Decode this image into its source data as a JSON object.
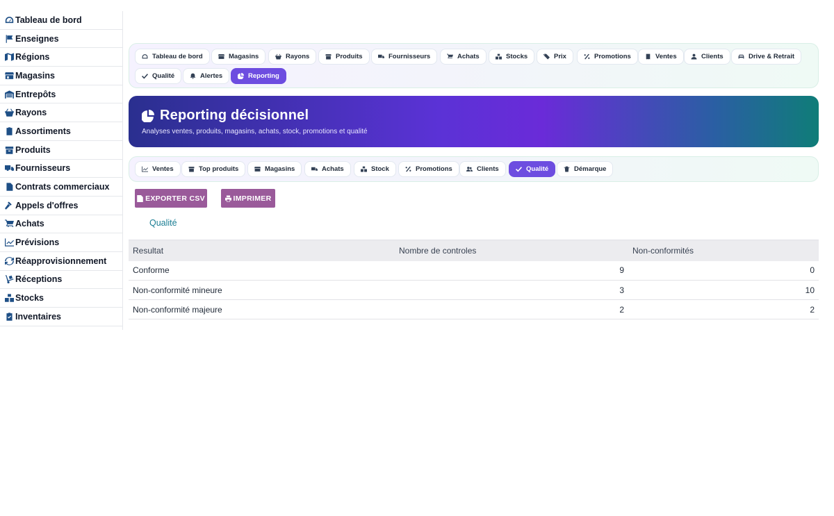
{
  "sidebar": {
    "items": [
      {
        "label": "Tableau de bord",
        "icon": "dashboard-icon"
      },
      {
        "label": "Enseignes",
        "icon": "flag-icon"
      },
      {
        "label": "Régions",
        "icon": "map-icon"
      },
      {
        "label": "Magasins",
        "icon": "store-icon"
      },
      {
        "label": "Entrepôts",
        "icon": "warehouse-icon"
      },
      {
        "label": "Rayons",
        "icon": "basket-icon"
      },
      {
        "label": "Assortiments",
        "icon": "clipboard-icon"
      },
      {
        "label": "Produits",
        "icon": "box-icon"
      },
      {
        "label": "Fournisseurs",
        "icon": "truck-icon"
      },
      {
        "label": "Contrats commerciaux",
        "icon": "contract-icon"
      },
      {
        "label": "Appels d'offres",
        "icon": "gavel-icon"
      },
      {
        "label": "Achats",
        "icon": "cart-icon"
      },
      {
        "label": "Prévisions",
        "icon": "chart-line-icon"
      },
      {
        "label": "Réapprovisionnement",
        "icon": "refresh-icon"
      },
      {
        "label": "Réceptions",
        "icon": "dolly-icon"
      },
      {
        "label": "Stocks",
        "icon": "cubes-icon"
      },
      {
        "label": "Inventaires",
        "icon": "clipboard-check-icon"
      }
    ]
  },
  "topnav": {
    "items": [
      {
        "label": "Tableau de bord"
      },
      {
        "label": "Magasins"
      },
      {
        "label": "Rayons"
      },
      {
        "label": "Produits"
      },
      {
        "label": "Fournisseurs"
      },
      {
        "label": "Achats"
      },
      {
        "label": "Stocks"
      },
      {
        "label": "Prix"
      },
      {
        "label": "Promotions"
      },
      {
        "label": "Ventes"
      },
      {
        "label": "Clients"
      },
      {
        "label": "Drive & Retrait"
      },
      {
        "label": "Qualité"
      },
      {
        "label": "Alertes"
      },
      {
        "label": "Reporting"
      }
    ],
    "active": "Reporting"
  },
  "hero": {
    "title": "Reporting décisionnel",
    "subtitle": "Analyses ventes, produits, magasins, achats, stock, promotions et qualité"
  },
  "subnav": {
    "items": [
      {
        "label": "Ventes"
      },
      {
        "label": "Top produits"
      },
      {
        "label": "Magasins"
      },
      {
        "label": "Achats"
      },
      {
        "label": "Stock"
      },
      {
        "label": "Promotions"
      },
      {
        "label": "Clients"
      },
      {
        "label": "Qualité"
      },
      {
        "label": "Démarque"
      }
    ],
    "active": "Qualité"
  },
  "actions": {
    "export_label": "EXPORTER CSV",
    "print_label": "IMPRIMER"
  },
  "section": {
    "title": "Qualité"
  },
  "table": {
    "headers": [
      "Resultat",
      "Nombre de controles",
      "Non-conformités"
    ],
    "rows": [
      [
        "Conforme",
        "9",
        "0"
      ],
      [
        "Non-conformité mineure",
        "3",
        "10"
      ],
      [
        "Non-conformité majeure",
        "2",
        "2"
      ]
    ]
  },
  "colors": {
    "accent": "#6d4de0",
    "button": "#9a5a9a",
    "section_title": "#1a7d93",
    "sidebar_icon": "#1e4f86"
  }
}
